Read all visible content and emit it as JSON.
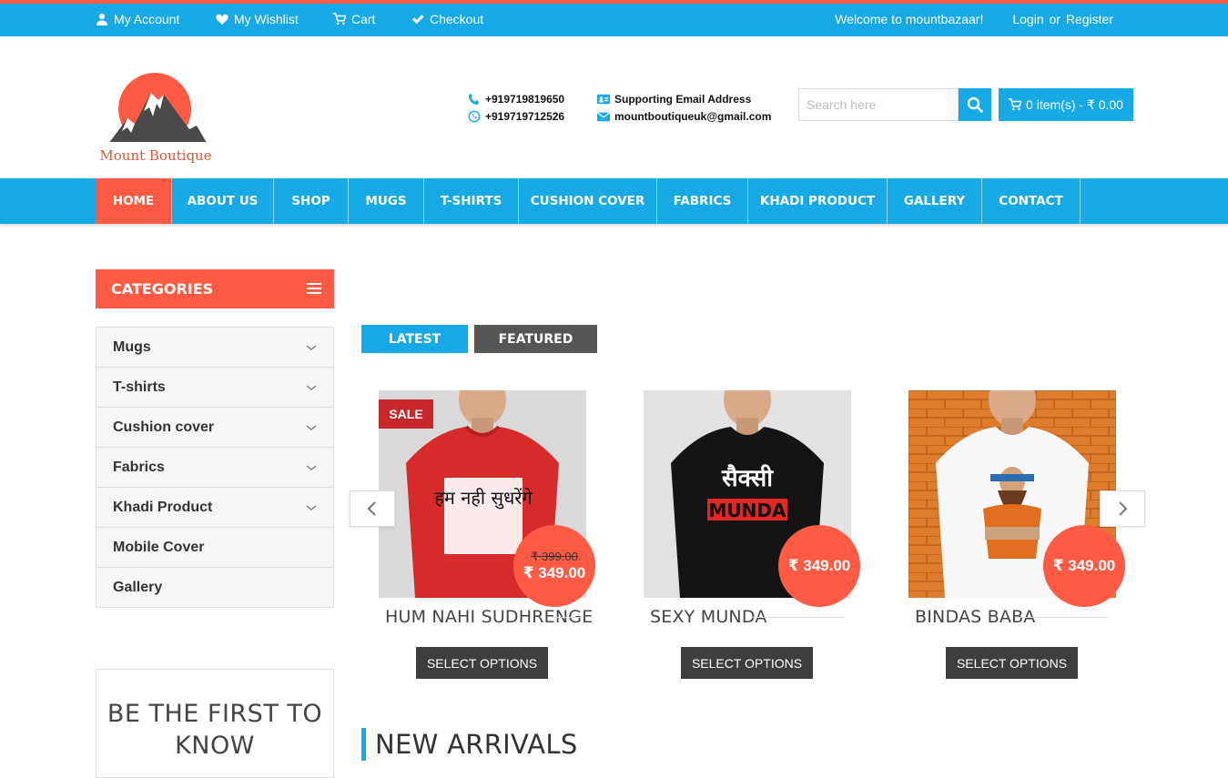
{
  "topbar": {
    "my_account": "My Account",
    "wishlist": "My Wishlist",
    "cart": "Cart",
    "checkout": "Checkout",
    "welcome": "Welcome to mountbazaar!",
    "login": "Login",
    "or": "or",
    "register": "Register"
  },
  "logo": {
    "text": "Mount Boutique"
  },
  "contact": {
    "phone": "+919719819650",
    "whatsapp": "+919719712526",
    "email_label": "Supporting Email Address",
    "email": "mountboutiqueuk@gmail.com"
  },
  "search": {
    "placeholder": "Search here"
  },
  "cart": {
    "label": "0 item(s) - ₹ 0.00"
  },
  "nav": [
    "HOME",
    "ABOUT US",
    "SHOP",
    "MUGS",
    "T-SHIRTS",
    "CUSHION COVER",
    "FABRICS",
    "KHADI PRODUCT",
    "GALLERY",
    "CONTACT"
  ],
  "categories": {
    "title": "CATEGORIES",
    "items": [
      "Mugs",
      "T-shirts",
      "Cushion cover",
      "Fabrics",
      "Khadi Product",
      "Mobile Cover",
      "Gallery"
    ]
  },
  "newsletter": {
    "title_line1": "BE THE FIRST TO",
    "title_line2": "KNOW"
  },
  "tabs": {
    "latest": "LATEST",
    "featured": "FEATURED"
  },
  "products": [
    {
      "name": "HUM NAHI SUDHRENGE",
      "price": "₹ 349.00",
      "old_price": "₹ 399.00",
      "sale": "SALE",
      "button": "SELECT OPTIONS",
      "print": "हम नही सुधरेंगे"
    },
    {
      "name": "SEXY MUNDA",
      "price": "₹ 349.00",
      "button": "SELECT OPTIONS",
      "print1": "सैक्सी",
      "print2": "MUNDA"
    },
    {
      "name": "BINDAS BABA",
      "price": "₹ 349.00",
      "button": "SELECT OPTIONS"
    }
  ],
  "sections": {
    "new_arrivals": "NEW ARRIVALS"
  },
  "colors": {
    "primary": "#16a9e6",
    "accent": "#ff5b44",
    "dark": "#3e3e3e"
  }
}
